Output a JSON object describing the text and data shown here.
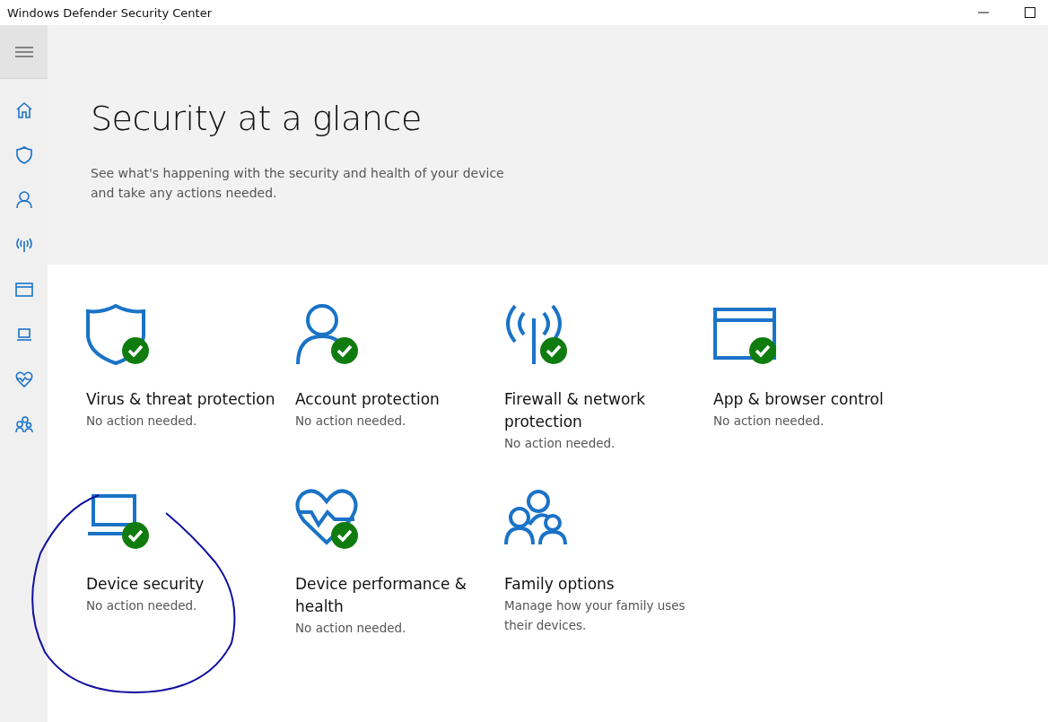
{
  "window": {
    "title": "Windows Defender Security Center"
  },
  "sidebar": {
    "items": [
      {
        "kind": "home"
      },
      {
        "kind": "shield"
      },
      {
        "kind": "person"
      },
      {
        "kind": "wireless"
      },
      {
        "kind": "window"
      },
      {
        "kind": "laptop"
      },
      {
        "kind": "heart"
      },
      {
        "kind": "family"
      }
    ]
  },
  "header": {
    "title": "Security at a glance",
    "subtitle": "See what's happening with the security and health of your device and take any actions needed."
  },
  "tiles": [
    {
      "kind": "shield",
      "title": "Virus & threat protection",
      "status": "No action needed.",
      "ok": true
    },
    {
      "kind": "person",
      "title": "Account protection",
      "status": "No action needed.",
      "ok": true
    },
    {
      "kind": "wireless",
      "title": "Firewall & network protection",
      "status": "No action needed.",
      "ok": true
    },
    {
      "kind": "window",
      "title": "App & browser control",
      "status": "No action needed.",
      "ok": true
    },
    {
      "kind": "laptop",
      "title": "Device security",
      "status": "No action needed.",
      "ok": true
    },
    {
      "kind": "heart",
      "title": "Device performance & health",
      "status": "No action needed.",
      "ok": true
    },
    {
      "kind": "family",
      "title": "Family options",
      "status": "Manage how your family uses their devices.",
      "ok": false
    }
  ]
}
